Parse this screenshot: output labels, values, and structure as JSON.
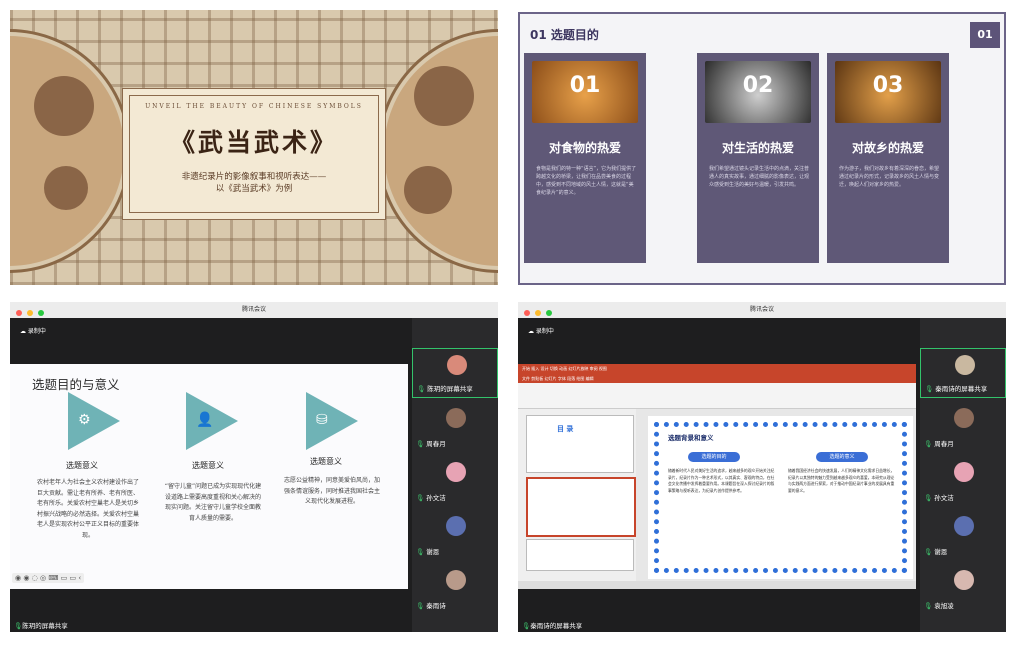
{
  "panel1": {
    "eyebrow": "UNVEIL THE BEAUTY OF CHINESE SYMBOLS",
    "title": "《武当武术》",
    "subtitle_line1": "非遗纪录片的影像叙事和视听表达——",
    "subtitle_line2": "以《武当武术》为例"
  },
  "panel2": {
    "heading": "01 选题目的",
    "page_num": "01",
    "columns": [
      {
        "num": "01",
        "title": "对食物的热爱",
        "photo_color": "#c9822c",
        "desc": "食物是我们的特一种“语言”，它为我们提供了跨越文化的桥梁，让我们在品尝美食的过程中，感受到不同地域的风土人情，这就是“美食纪录片”的意义。"
      },
      {
        "num": "02",
        "title": "对生活的热爱",
        "photo_color": "#6f6f6f",
        "desc": "我们希望通过镜头记录生活中的点滴，关注普通人的真实故事，通过细腻的影像表达，让观众感受到生活的美好与温暖，引发共鸣。"
      },
      {
        "num": "03",
        "title": "对故乡的热爱",
        "photo_color": "#b2762a",
        "desc": "作为游子，我们对故乡有着深深的眷恋，希望通过纪录片的形式，记录故乡的风土人情与变迁，唤起人们对家乡的热爱。"
      }
    ]
  },
  "meeting": {
    "app_title": "腾讯会议",
    "recording": "录制中"
  },
  "panel3": {
    "slide_title": "选题目的与意义",
    "cards": [
      {
        "title": "选题意义",
        "icon": "gear-icon",
        "symbol": "⚙",
        "text": "农村老年人为社会主义农村建设作出了巨大贡献。需让老有所养、老有所医、老有所乐。关爱农村空巢老人是关切乡村振兴战略的必然选择。关爱农村空巢老人是实现农村公平正义目标的重要体现。"
      },
      {
        "title": "选题意义",
        "icon": "person-icon",
        "symbol": "👤",
        "text": "“留守儿童”问题已成为实现现代化建设道路上需要高度重视和关心解决的现实问题。关注留守儿童学校全面教育人质量的需要。"
      },
      {
        "title": "选题意义",
        "icon": "coins-icon",
        "symbol": "⛁",
        "text": "志愿公益精神，同意美爱伯风尚，加强条情谊服务，同时推进我国社会主义现代化发展进程。"
      }
    ],
    "tools": "◉ ◉ ◌ ◎ ⌨ ▭ ▭ ‹",
    "share_label": "陈玥的屏幕共享",
    "participants": [
      {
        "name": "陈玥的屏幕共享",
        "color": "#d98a7a"
      },
      {
        "name": "周春月",
        "color": "#8b6b5a"
      },
      {
        "name": "孙文洁",
        "color": "#e7a3b4"
      },
      {
        "name": "谢恩",
        "color": "#5b6fb0"
      },
      {
        "name": "秦雨诗",
        "color": "#b89a8a"
      }
    ]
  },
  "panel4": {
    "ribbon": "开始  插入  设计  切换  动画  幻灯片放映  审阅  视图",
    "ribbon2": "文件  剪贴板  幻灯片  字体  段落  绘图  编辑",
    "toc_title": "目 录",
    "main_title": "选题背景和意义",
    "pill_left": "选题的目的",
    "pill_right": "选题的意义",
    "para_left": "随着新时代人民对美好生活的追求，越来越多的观众开始关注纪录片，纪录片作为一种艺术形式，以其真实、客观的特点，在社会文化传播中发挥着重要作用。本课题旨在深入探讨纪录片的叙事策略与视听表达，为纪录片创作提供参考。",
    "para_right": "随着我国经济社会的快速发展，人们的精神文化需求日益增长，纪录片以其独特的魅力受到越来越多观众的喜爱。本研究从理论与实践两方面进行探索，对于推动中国纪录片事业的发展具有重要的意义。",
    "share_label": "秦雨诗的屏幕共享",
    "participants": [
      {
        "name": "秦雨诗的屏幕共享",
        "color": "#c9b8a0"
      },
      {
        "name": "周春月",
        "color": "#8b6b5a"
      },
      {
        "name": "孙文洁",
        "color": "#e7a3b4"
      },
      {
        "name": "谢恩",
        "color": "#5b6fb0"
      },
      {
        "name": "袁旭凌",
        "color": "#d7b8b0"
      }
    ]
  },
  "colors": {
    "active_green": "#33c36b",
    "purple": "#5f5877",
    "teal": "#6fb3b6",
    "ppt_red": "#c7452b"
  }
}
